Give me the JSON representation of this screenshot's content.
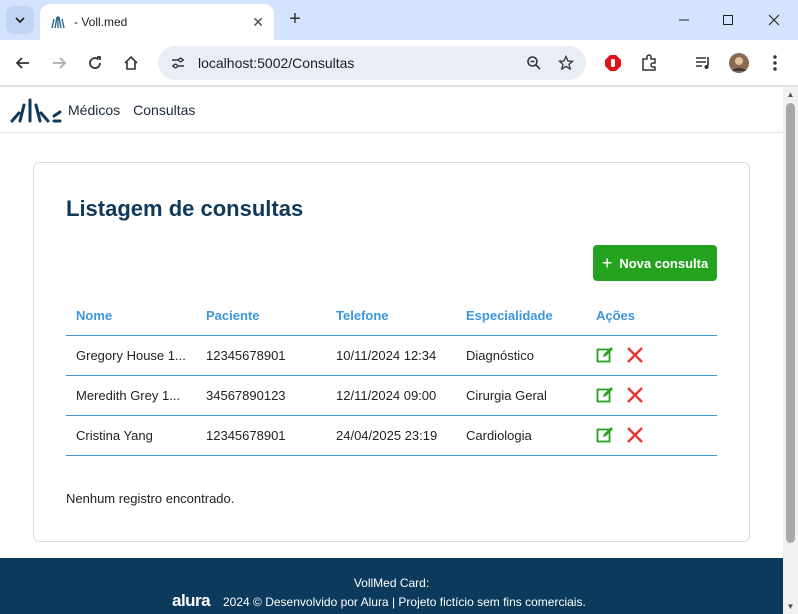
{
  "browser": {
    "tab_title": "- Voll.med",
    "url": "localhost:5002/Consultas"
  },
  "nav": {
    "items": [
      {
        "label": "Médicos"
      },
      {
        "label": "Consultas"
      }
    ]
  },
  "main": {
    "title": "Listagem de consultas",
    "new_button": "Nova consulta",
    "columns": [
      "Nome",
      "Paciente",
      "Telefone",
      "Especialidade",
      "Ações"
    ],
    "rows": [
      {
        "nome": "Gregory House 1...",
        "paciente": "12345678901",
        "telefone": "10/11/2024 12:34",
        "especialidade": "Diagnóstico"
      },
      {
        "nome": "Meredith Grey 1...",
        "paciente": "34567890123",
        "telefone": "12/11/2024 09:00",
        "especialidade": "Cirurgia Geral"
      },
      {
        "nome": "Cristina Yang",
        "paciente": "12345678901",
        "telefone": "24/04/2025 23:19",
        "especialidade": "Cardiologia"
      }
    ],
    "empty_message": "Nenhum registro encontrado."
  },
  "footer": {
    "line1": "VollMed Card:",
    "brand": "alura",
    "line2": "2024 © Desenvolvido por Alura | Projeto fictício sem fins comerciais."
  },
  "colors": {
    "primary": "#10395a",
    "accent": "#3c97dc",
    "button": "#26a221",
    "delete": "#e53935",
    "footer": "#0b3a5c"
  }
}
